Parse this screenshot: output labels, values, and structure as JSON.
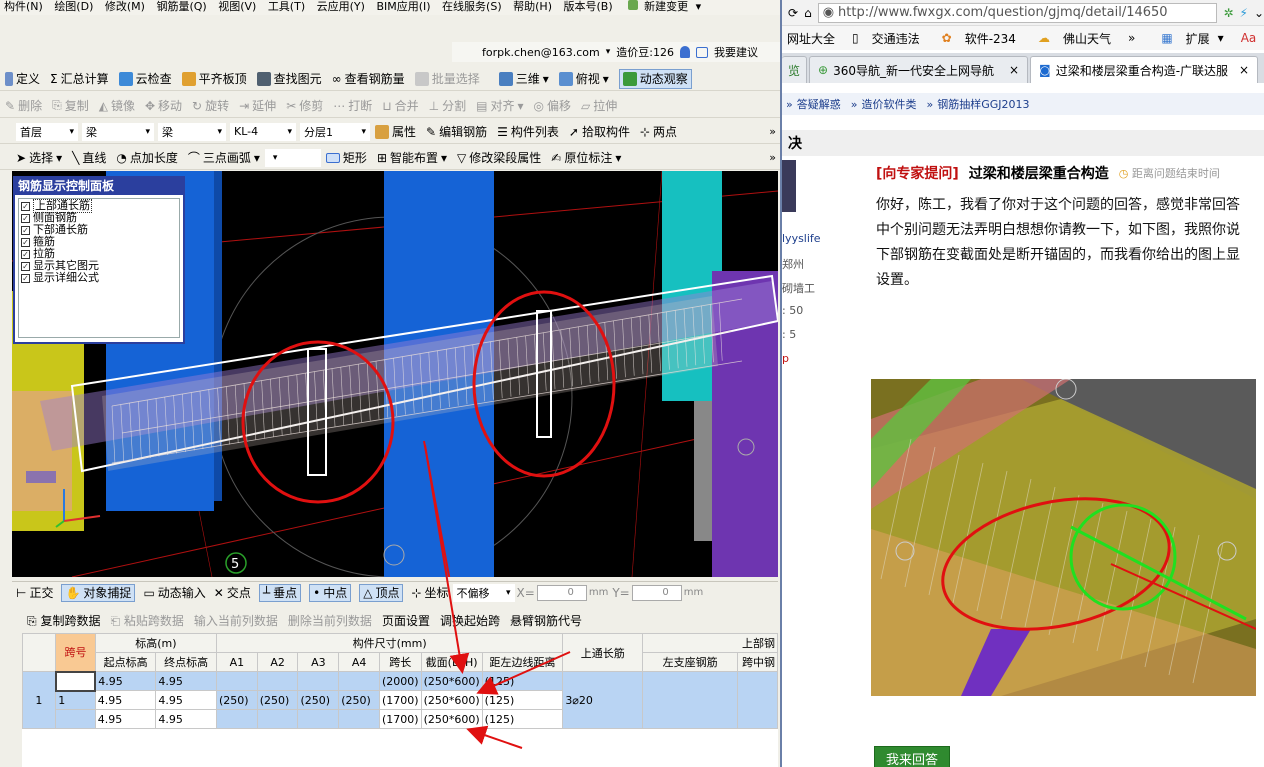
{
  "app": {
    "menu": [
      "构件(N)",
      "绘图(D)",
      "修改(M)",
      "钢筋量(Q)",
      "视图(V)",
      "工具(T)",
      "云应用(Y)",
      "BIM应用(I)",
      "在线服务(S)",
      "帮助(H)",
      "版本号(B)",
      "新建变更"
    ],
    "user": {
      "email": "forpk.chen@163.com",
      "price_label": "造价豆:126",
      "suggest": "我要建议"
    },
    "toolbar1": {
      "define": "定义",
      "calc": "汇总计算",
      "cloud_check": "云检查",
      "align_slab": "平齐板顶",
      "find_elem": "查找图元",
      "view_rebar": "查看钢筋量",
      "batch_select": "批量选择",
      "view_3d": "三维",
      "top_view": "俯视",
      "dynamic_view": "动态观察"
    },
    "toolbar2": [
      "删除",
      "复制",
      "镜像",
      "移动",
      "旋转",
      "延伸",
      "修剪",
      "打断",
      "合并",
      "分割",
      "对齐",
      "偏移",
      "拉伸"
    ],
    "toolbar3": {
      "floor": "首层",
      "type1": "梁",
      "type2": "梁",
      "code": "KL-4",
      "layer": "分层1",
      "props": "属性",
      "edit_rebar": "编辑钢筋",
      "member_list": "构件列表",
      "pick": "拾取构件",
      "two_points": "两点"
    },
    "toolbar4": {
      "select": "选择",
      "line": "直线",
      "point_len": "点加长度",
      "arc": "三点画弧",
      "rect": "矩形",
      "smart": "智能布置",
      "modify_span": "修改梁段属性",
      "in_situ": "原位标注"
    },
    "control_panel": {
      "title": "钢筋显示控制面板",
      "items": [
        "上部通长筋",
        "侧面钢筋",
        "下部通长筋",
        "箍筋",
        "拉筋",
        "显示其它图元",
        "显示详细公式"
      ]
    },
    "view_marker": "5",
    "snapbar": {
      "ortho": "正交",
      "snap": "对象捕捉",
      "dyn_input": "动态输入",
      "intersect": "交点",
      "perp": "垂点",
      "mid": "中点",
      "vertex": "顶点",
      "coord": "坐标",
      "no_offset": "不偏移",
      "x_label": "X=",
      "x_val": "0",
      "y_label": "Y=",
      "y_val": "0",
      "unit": "mm"
    },
    "gridbar": {
      "copy": "复制跨数据",
      "paste": "粘贴跨数据",
      "input_col": "输入当前列数据",
      "del_col": "删除当前列数据",
      "page_setup": "页面设置",
      "swap_start": "调换起始跨",
      "cantilever": "悬臂钢筋代号"
    },
    "table": {
      "h_span": "跨号",
      "h_elev": "标高(m)",
      "h_start_elev": "起点标高",
      "h_end_elev": "终点标高",
      "h_dims": "构件尺寸(mm)",
      "h_a1": "A1",
      "h_a2": "A2",
      "h_a3": "A3",
      "h_a4": "A4",
      "h_len": "跨长",
      "h_sec": "截面(B*H)",
      "h_edge": "距左边线距离",
      "h_top_through": "上通长筋",
      "h_top": "上部钢",
      "h_left_seat": "左支座钢筋",
      "h_mid": "跨中钢",
      "row_index": "1",
      "rows": [
        {
          "span": "",
          "start": "4.95",
          "end": "4.95",
          "a1": "",
          "a2": "",
          "a3": "",
          "a4": "",
          "len": "(2000)",
          "sec": "(250*600)",
          "edge": "(125)"
        },
        {
          "span": "1",
          "start": "4.95",
          "end": "4.95",
          "a1": "(250)",
          "a2": "(250)",
          "a3": "(250)",
          "a4": "(250)",
          "len": "(1700)",
          "sec": "(250*600)",
          "edge": "(125)"
        },
        {
          "span": "",
          "start": "4.95",
          "end": "4.95",
          "a1": "",
          "a2": "",
          "a3": "",
          "a4": "",
          "len": "(1700)",
          "sec": "(250*600)",
          "edge": "(125)"
        }
      ],
      "top_through_val": "3⌀20"
    }
  },
  "browser": {
    "url": "http://www.fwxgx.com/question/gjmq/detail/14650",
    "bookmarks": [
      "网址大全",
      "交通违法",
      "软件-234",
      "佛山天气",
      "扩展",
      "翻译"
    ],
    "tabs": [
      "览",
      "360导航_新一代安全上网导航",
      "过梁和楼层梁重合构造-广联达服"
    ],
    "crumb": [
      "答疑解惑",
      "造价软件类",
      "钢筋抽样GGJ2013"
    ],
    "section": "决",
    "user": {
      "name": "lyyslife",
      "city": "郑州",
      "role": "砌墙工",
      "n1": ": 50",
      "n2": ": 5",
      "p": "p"
    },
    "question": {
      "tag": "[向专家提问]",
      "title": "过梁和楼层梁重合构造",
      "timer": "距离问题结束时间"
    },
    "body": [
      "你好，陈工，我看了你对于这个问题的回答，感觉非常回答",
      "中个别问题无法弄明白想想你请教一下，如下图，我照你说",
      "下部钢筋在变截面处是断开锚固的，而我看你给出的图上显",
      "设置。"
    ],
    "answer_btn": "我来回答"
  }
}
